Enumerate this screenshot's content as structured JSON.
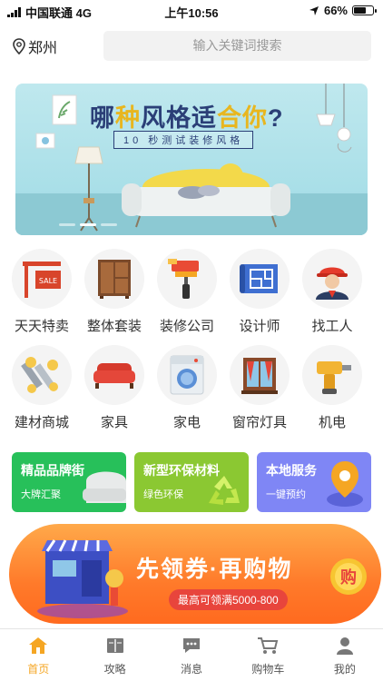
{
  "status": {
    "carrier": "中国联通 4G",
    "time": "上午10:56",
    "battery": "66%",
    "battery_level": 0.66
  },
  "header": {
    "city": "郑州",
    "search_placeholder": "输入关键词搜索"
  },
  "banner": {
    "headline_a": "哪",
    "headline_b": "种",
    "headline_c": "风格适",
    "headline_d": "合你",
    "headline_e": "?",
    "sub": "10 秒测试装修风格",
    "sale": "SALE"
  },
  "categories": [
    {
      "label": "天天特卖",
      "icon": "sale-sign-icon"
    },
    {
      "label": "整体套装",
      "icon": "wardrobe-icon"
    },
    {
      "label": "装修公司",
      "icon": "paint-roller-icon"
    },
    {
      "label": "设计师",
      "icon": "blueprint-icon"
    },
    {
      "label": "找工人",
      "icon": "worker-icon"
    },
    {
      "label": "建材商城",
      "icon": "screws-icon"
    },
    {
      "label": "家具",
      "icon": "sofa-icon"
    },
    {
      "label": "家电",
      "icon": "washing-machine-icon"
    },
    {
      "label": "窗帘灯具",
      "icon": "window-curtain-icon"
    },
    {
      "label": "机电",
      "icon": "drill-icon"
    }
  ],
  "cards": [
    {
      "title": "精品品牌街",
      "sub": "大牌汇聚",
      "color": "#27c05a"
    },
    {
      "title": "新型环保材料",
      "sub": "绿色环保",
      "color": "#8bc832"
    },
    {
      "title": "本地服务",
      "sub": "一键预约",
      "color": "#7f86f5"
    }
  ],
  "promo": {
    "title": "先领券·再购物",
    "tag": "最高可领满5000-800",
    "coin": "购"
  },
  "tabs": [
    {
      "label": "首页",
      "icon": "home-icon",
      "active": true
    },
    {
      "label": "攻略",
      "icon": "book-icon"
    },
    {
      "label": "消息",
      "icon": "message-icon"
    },
    {
      "label": "购物车",
      "icon": "cart-icon"
    },
    {
      "label": "我的",
      "icon": "user-icon"
    }
  ],
  "colors": {
    "accent": "#f5a623",
    "banner_bg": "#bfe8ee",
    "promo": "#ff7a2a"
  }
}
